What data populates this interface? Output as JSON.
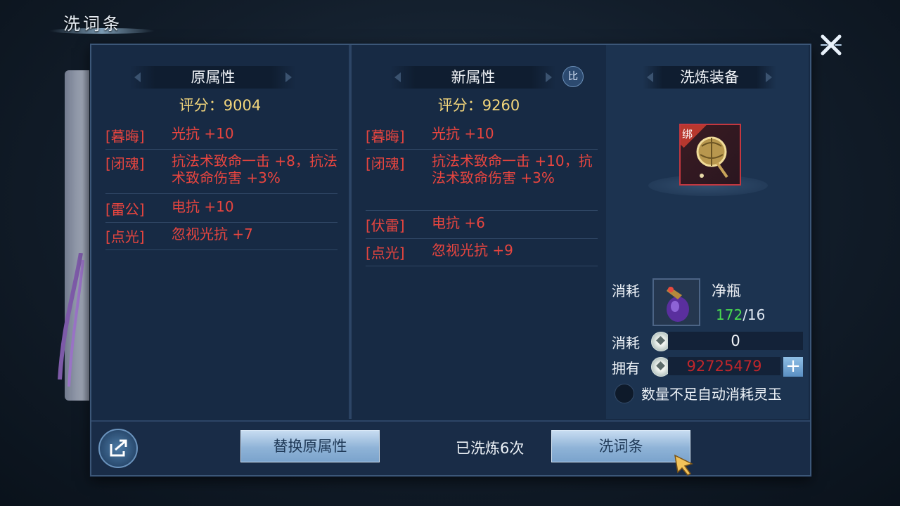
{
  "window": {
    "title": "洗词条"
  },
  "original": {
    "header": "原属性",
    "score_label": "评分：",
    "score": "9004",
    "attributes": [
      {
        "tag": "[暮晦]",
        "value": "光抗 +10"
      },
      {
        "tag": "[闭魂]",
        "value": "抗法术致命一击 +8，抗法术致命伤害 +3%"
      },
      {
        "tag": "[雷公]",
        "value": "电抗 +10"
      },
      {
        "tag": "[点光]",
        "value": "忽视光抗 +7"
      }
    ]
  },
  "new": {
    "header": "新属性",
    "compare_label": "比",
    "score_label": "评分：",
    "score": "9260",
    "attributes": [
      {
        "tag": "[暮晦]",
        "value": "光抗 +10"
      },
      {
        "tag": "[闭魂]",
        "value": "抗法术致命一击 +10，抗法术致命伤害 +3%"
      },
      {
        "tag": "[伏雷]",
        "value": "电抗 +6"
      },
      {
        "tag": "[点光]",
        "value": "忽视光抗 +9"
      }
    ]
  },
  "equip": {
    "header": "洗炼装备",
    "bind_label": "绑",
    "cost_label": "消耗",
    "material_name": "净瓶",
    "material_have": "172",
    "material_need": "/16",
    "coin_cost_label": "消耗",
    "coin_cost": "0",
    "own_label": "拥有",
    "own_amount": "92725479",
    "plus_label": "+",
    "auto_consume_label": "数量不足自动消耗灵玉"
  },
  "actions": {
    "replace_label": "替换原属性",
    "wash_count_label": "已洗炼6次",
    "wash_label": "洗词条"
  },
  "colors": {
    "attr_red": "#e8453f",
    "score_gold": "#f3d67c",
    "have_green": "#48d94f",
    "own_red": "#c0262b"
  }
}
